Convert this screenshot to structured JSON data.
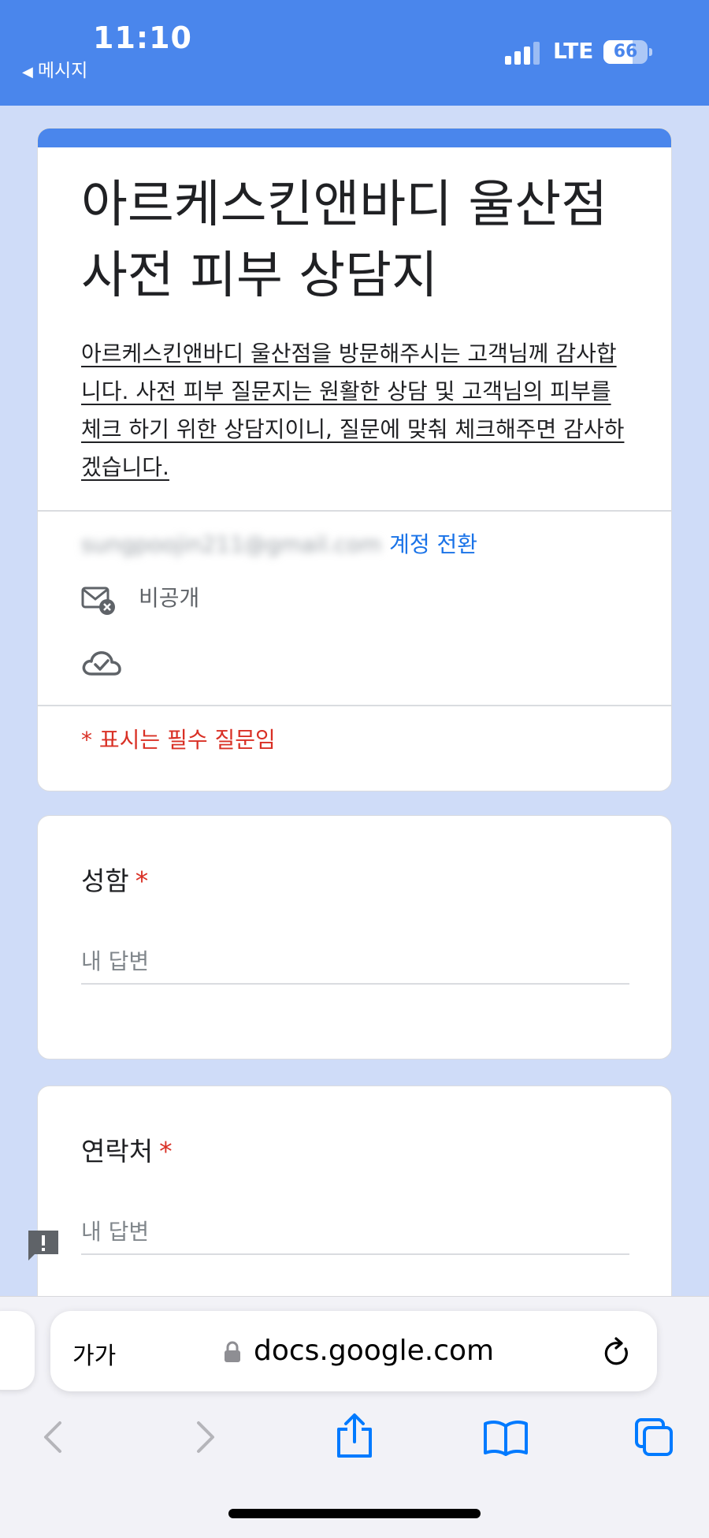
{
  "status_bar": {
    "time": "11:10",
    "back_label": "메시지",
    "network": "LTE",
    "battery_percent": "66",
    "battery_level": 66
  },
  "form": {
    "title": "아르케스킨앤바디 울산점 사전 피부 상담지",
    "description": "아르케스킨앤바디 울산점을 방문해주시는 고객님께 감사합니다. 사전 피부 질문지는 원활한 상담 및 고객님의 피부를 체크 하기 위한 상담지이니, 질문에 맞춰 체크해주면 감사하겠습니다.",
    "account_email": "sungpoojin211@gmail.com",
    "switch_account_label": "계정 전환",
    "private_label": "비공개",
    "required_note": "* 표시는 필수 질문임"
  },
  "questions": [
    {
      "label": "성함",
      "required_mark": "*",
      "placeholder": "내 답변"
    },
    {
      "label": "연락처",
      "required_mark": "*",
      "placeholder": "내 답변"
    }
  ],
  "browser": {
    "text_size_label": "가가",
    "url": "docs.google.com"
  },
  "colors": {
    "accent": "#4a86ec",
    "background": "#cfdcf8",
    "required": "#d93025",
    "link": "#1a73e8",
    "ios_blue": "#007aff"
  },
  "icons": {
    "private": "mail-x-icon",
    "saved": "cloud-check-icon",
    "feedback": "feedback-icon",
    "lock": "lock-icon",
    "reload": "reload-icon",
    "back": "chevron-left-icon",
    "forward": "chevron-right-icon",
    "share": "share-icon",
    "bookmarks": "book-icon",
    "tabs": "tabs-icon"
  }
}
